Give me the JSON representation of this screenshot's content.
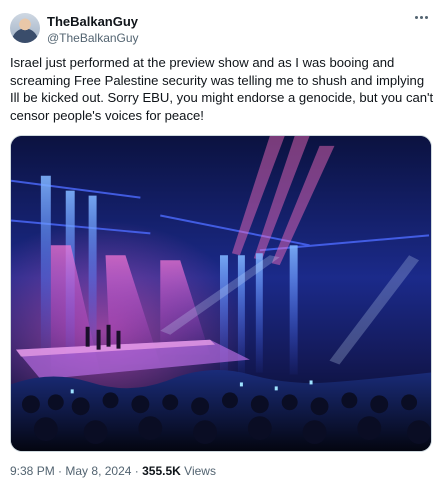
{
  "user": {
    "display_name": "TheBalkanGuy",
    "handle": "@TheBalkanGuy"
  },
  "tweet": {
    "text": "Israel just performed at the preview show and as I was booing and screaming Free Palestine security was telling me to shush and implying Ill be kicked out. Sorry EBU, you might endorse a genocide, but you can't censor people's voices for peace!",
    "time": "9:38 PM",
    "separator1": "·",
    "date": "May 8, 2024",
    "separator2": "·",
    "views_count": "355.5K",
    "views_label": "Views"
  },
  "icons": {
    "more": "more-dots-icon",
    "avatar": "avatar"
  }
}
